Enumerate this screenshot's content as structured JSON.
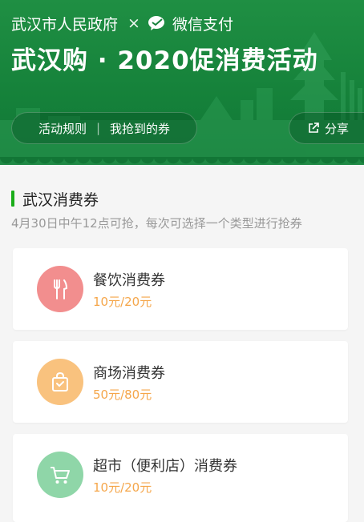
{
  "header": {
    "issuer": "武汉市人民政府",
    "times": "×",
    "partner": "微信支付",
    "title": "武汉购 · 2020促消费活动",
    "nav": {
      "rules": "活动规则",
      "separator": "|",
      "my_coupons": "我抢到的券"
    },
    "share": "分享"
  },
  "section": {
    "title": "武汉消费券",
    "desc": "4月30日中午12点可抢，每次可选择一个类型进行抢券"
  },
  "coupons": [
    {
      "name": "餐饮消费券",
      "price": "10元/20元",
      "icon": "utensils-icon",
      "color": "#f28e8e"
    },
    {
      "name": "商场消费券",
      "price": "50元/80元",
      "icon": "shopping-bag-icon",
      "color": "#f9c27e"
    },
    {
      "name": "超市（便利店）消费券",
      "price": "10元/20元",
      "icon": "shopping-cart-icon",
      "color": "#8fd6a8"
    }
  ],
  "colors": {
    "header_green": "#15813a",
    "accent_green": "#1aad19",
    "price_orange": "#f5a64a"
  }
}
